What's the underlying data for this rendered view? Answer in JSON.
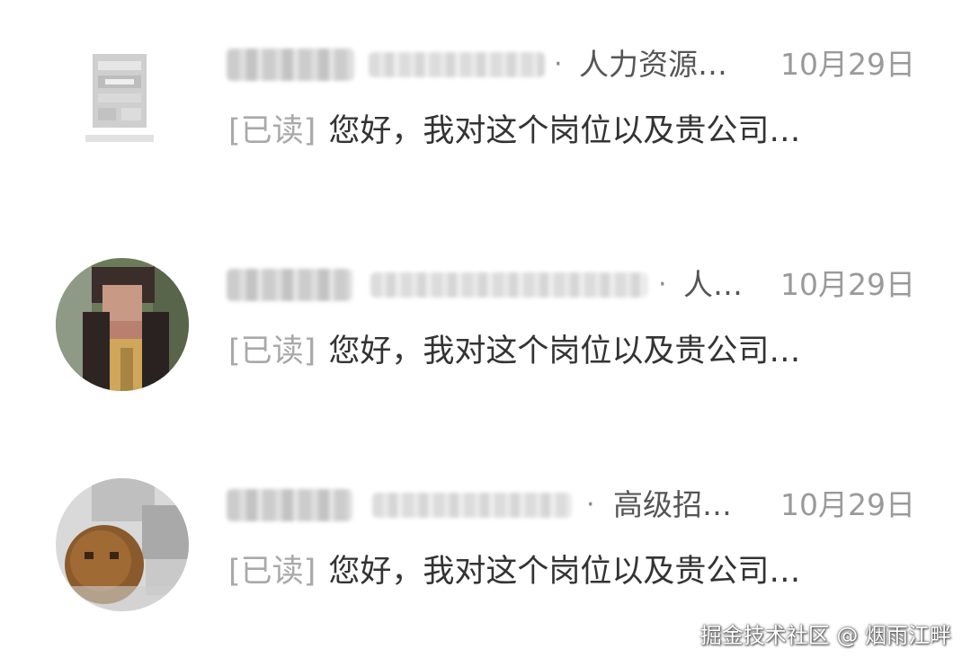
{
  "chats": [
    {
      "role": "人力资源…",
      "date": "10月29日",
      "read_tag": "[已读]",
      "message": "您好，我对这个岗位以及贵公司…"
    },
    {
      "role": "人…",
      "date": "10月29日",
      "read_tag": "[已读]",
      "message": "您好，我对这个岗位以及贵公司…"
    },
    {
      "role": "高级招…",
      "date": "10月29日",
      "read_tag": "[已读]",
      "message": "您好，我对这个岗位以及贵公司…"
    }
  ],
  "separator": "·",
  "watermark": "掘金技术社区 @ 烟雨江畔",
  "colors": {
    "text_primary": "#333333",
    "text_secondary": "#9a9a9a",
    "read_tag": "#a9a9a9",
    "background": "#ffffff"
  }
}
